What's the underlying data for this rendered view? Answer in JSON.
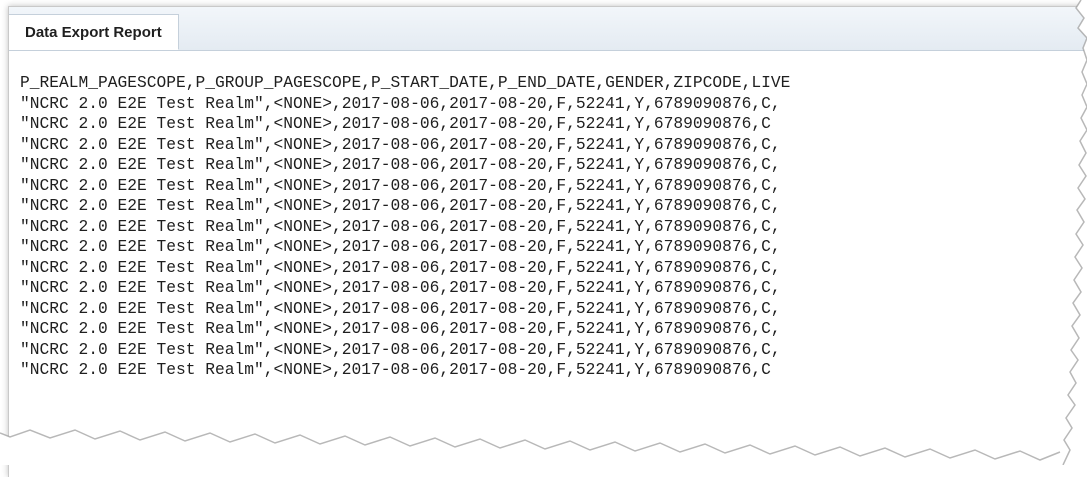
{
  "tab": {
    "label": "Data Export Report"
  },
  "report": {
    "header_line": "P_REALM_PAGESCOPE,P_GROUP_PAGESCOPE,P_START_DATE,P_END_DATE,GENDER,ZIPCODE,LIVE",
    "rows": [
      "\"NCRC 2.0 E2E Test Realm\",<NONE>,2017-08-06,2017-08-20,F,52241,Y,6789090876,C,",
      "\"NCRC 2.0 E2E Test Realm\",<NONE>,2017-08-06,2017-08-20,F,52241,Y,6789090876,C",
      "\"NCRC 2.0 E2E Test Realm\",<NONE>,2017-08-06,2017-08-20,F,52241,Y,6789090876,C,",
      "\"NCRC 2.0 E2E Test Realm\",<NONE>,2017-08-06,2017-08-20,F,52241,Y,6789090876,C,",
      "\"NCRC 2.0 E2E Test Realm\",<NONE>,2017-08-06,2017-08-20,F,52241,Y,6789090876,C,",
      "\"NCRC 2.0 E2E Test Realm\",<NONE>,2017-08-06,2017-08-20,F,52241,Y,6789090876,C,",
      "\"NCRC 2.0 E2E Test Realm\",<NONE>,2017-08-06,2017-08-20,F,52241,Y,6789090876,C,",
      "\"NCRC 2.0 E2E Test Realm\",<NONE>,2017-08-06,2017-08-20,F,52241,Y,6789090876,C,",
      "\"NCRC 2.0 E2E Test Realm\",<NONE>,2017-08-06,2017-08-20,F,52241,Y,6789090876,C,",
      "\"NCRC 2.0 E2E Test Realm\",<NONE>,2017-08-06,2017-08-20,F,52241,Y,6789090876,C,",
      "\"NCRC 2.0 E2E Test Realm\",<NONE>,2017-08-06,2017-08-20,F,52241,Y,6789090876,C,",
      "\"NCRC 2.0 E2E Test Realm\",<NONE>,2017-08-06,2017-08-20,F,52241,Y,6789090876,C,",
      "\"NCRC 2.0 E2E Test Realm\",<NONE>,2017-08-06,2017-08-20,F,52241,Y,6789090876,C,",
      "\"NCRC 2.0 E2E Test Realm\",<NONE>,2017-08-06,2017-08-20,F,52241,Y,6789090876,C"
    ]
  }
}
